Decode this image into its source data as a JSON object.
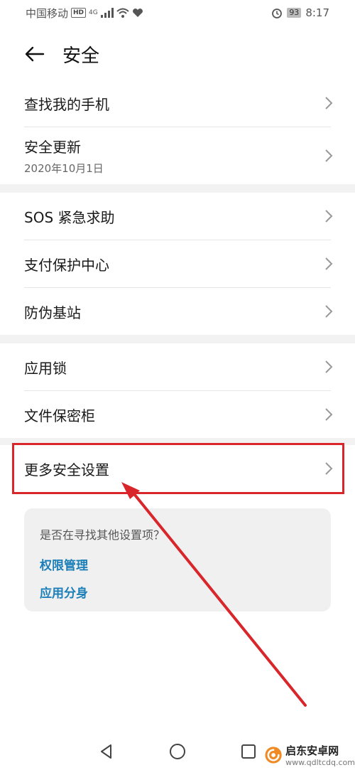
{
  "status_bar": {
    "carrier": "中国移动",
    "hd": "HD",
    "signal": "4G",
    "battery": "93",
    "time": "8:17"
  },
  "header": {
    "title": "安全"
  },
  "items": [
    {
      "label": "查找我的手机"
    },
    {
      "label": "安全更新",
      "sub": "2020年10月1日"
    },
    {
      "label": "SOS 紧急求助"
    },
    {
      "label": "支付保护中心"
    },
    {
      "label": "防伪基站"
    },
    {
      "label": "应用锁"
    },
    {
      "label": "文件保密柜"
    },
    {
      "label": "更多安全设置"
    }
  ],
  "suggest": {
    "question": "是否在寻找其他设置项？",
    "links": [
      "权限管理",
      "应用分身"
    ]
  },
  "watermark": {
    "name": "启东安卓网",
    "url": "www.qdltcdq.com"
  },
  "colors": {
    "accent_link": "#1c7fb8",
    "annotation_red": "#d8262b"
  }
}
